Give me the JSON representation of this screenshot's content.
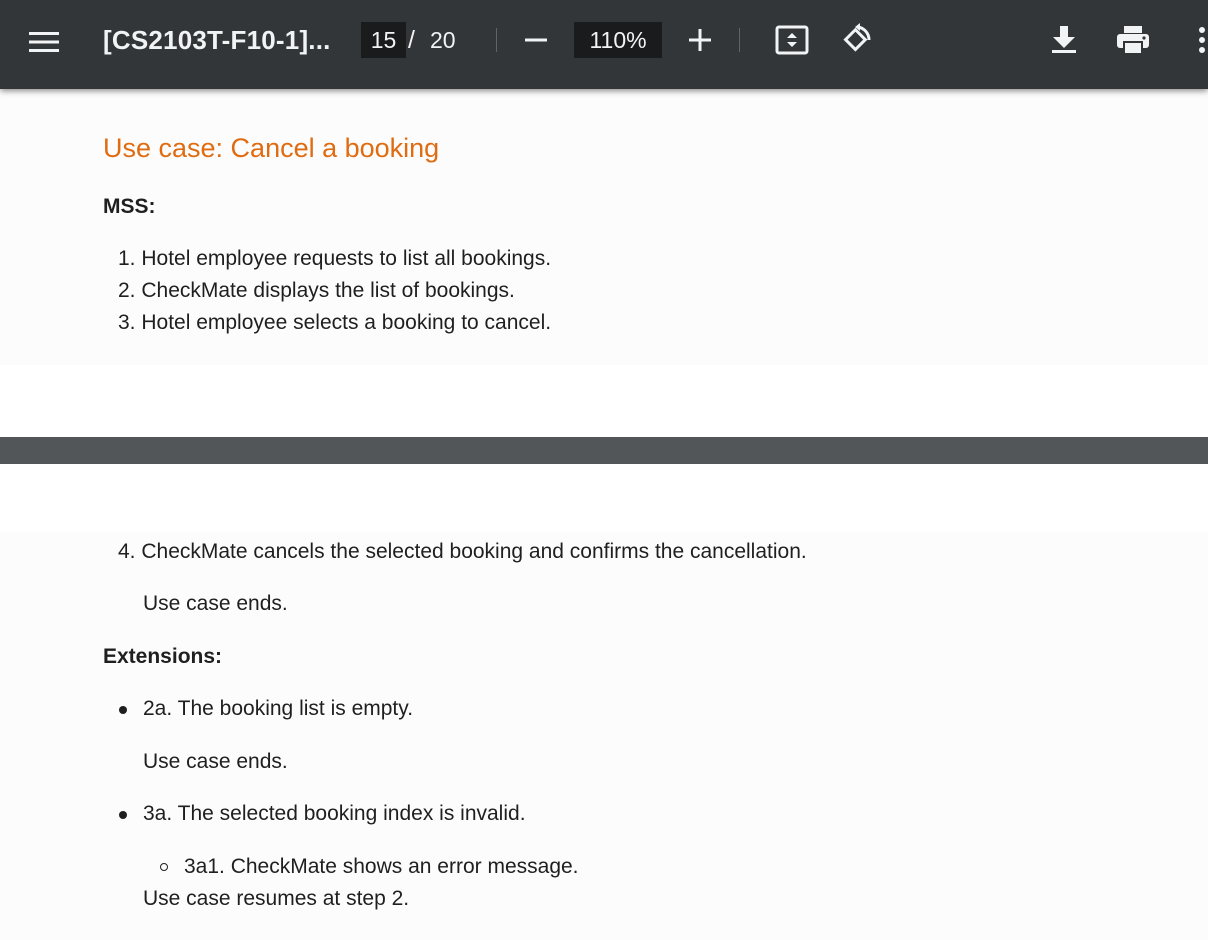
{
  "toolbar": {
    "title": "[CS2103T-F10-1]...",
    "current_page": "15",
    "page_separator": "/",
    "total_pages": "20",
    "zoom": "110%",
    "icons": [
      "menu-icon",
      "zoom-out-icon",
      "zoom-in-icon",
      "fit-to-page-icon",
      "rotate-icon",
      "download-icon",
      "print-icon",
      "more-vertical-icon"
    ]
  },
  "page1": {
    "heading": "Use case: Cancel a booking",
    "mss_label": "MSS:",
    "steps": [
      "1. Hotel employee requests to list all bookings.",
      "2. CheckMate displays the list of bookings.",
      "3. Hotel employee selects a booking to cancel."
    ]
  },
  "page2": {
    "step4": "4. CheckMate cancels the selected booking and confirms the cancellation.",
    "step4_end": "Use case ends.",
    "extensions_label": "Extensions:",
    "ext_2a": "2a. The booking list is empty.",
    "ext_2a_end": "Use case ends.",
    "ext_3a": "3a. The selected booking index is invalid.",
    "ext_3a1": "3a1. CheckMate shows an error message.",
    "ext_3a_resume": "Use case resumes at step 2."
  },
  "colors": {
    "toolbar_bg": "#323639",
    "heading_accent": "#e06c12",
    "viewer_bg": "#525659"
  }
}
